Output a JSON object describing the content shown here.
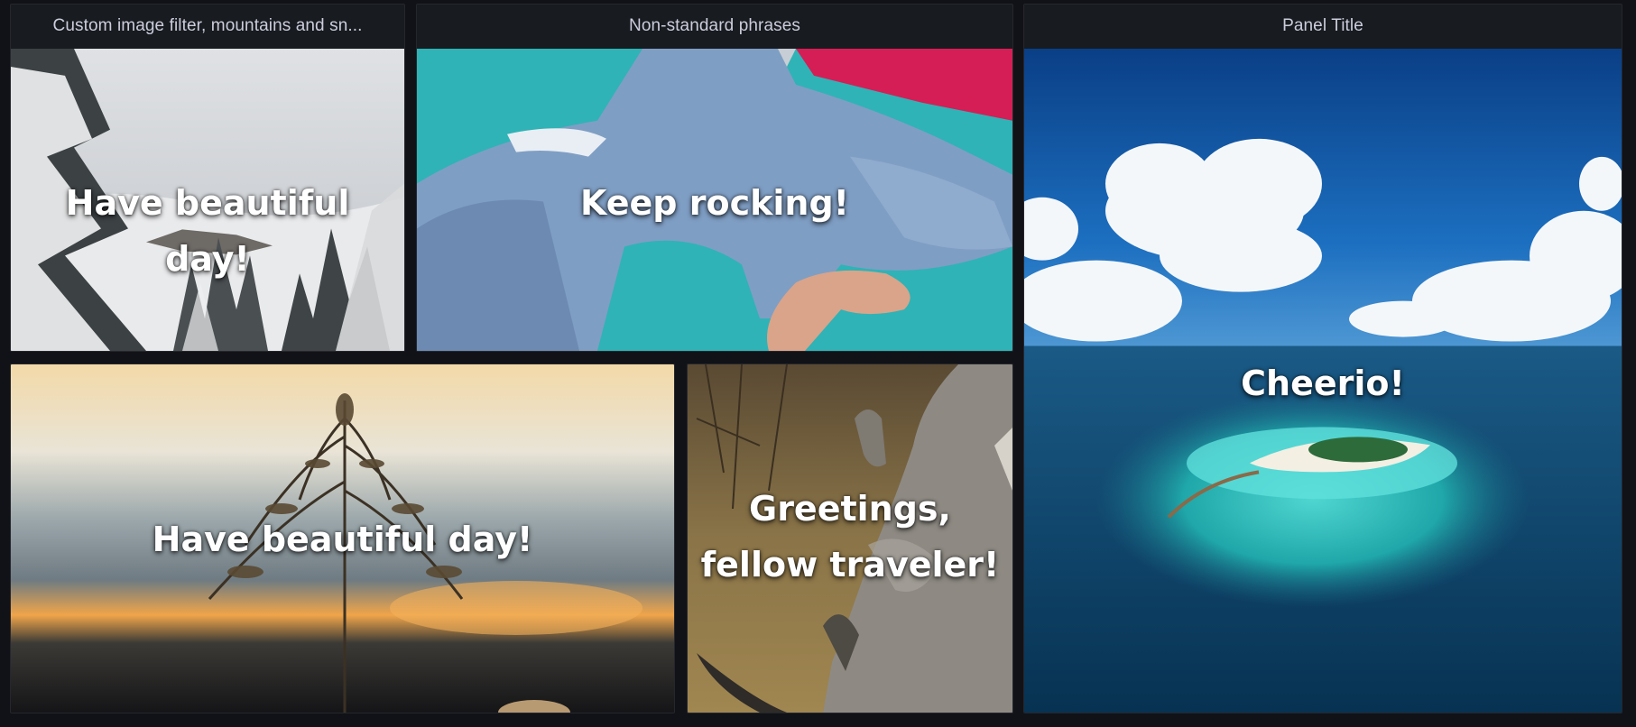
{
  "dashboard": {
    "background_color": "#111217",
    "panel_background_color": "#181b1f",
    "text_color": "#ccccdc"
  },
  "panels": [
    {
      "title": "Custom image filter, mountains and sn...",
      "phrase": "Have beautiful day!",
      "image_subject": "snowy-mountain-forest-photo"
    },
    {
      "title": "Non-standard phrases",
      "phrase": "Keep rocking!",
      "image_subject": "jeans-on-teal-background-photo"
    },
    {
      "title": "Panel Title",
      "phrase": "Cheerio!",
      "image_subject": "tropical-island-aerial-photo"
    },
    {
      "title": "",
      "phrase": "Have beautiful day!",
      "image_subject": "grass-at-sunset-photo"
    },
    {
      "title": "",
      "phrase": "Greetings, fellow traveler!",
      "image_subject": "rhino-photo"
    }
  ]
}
